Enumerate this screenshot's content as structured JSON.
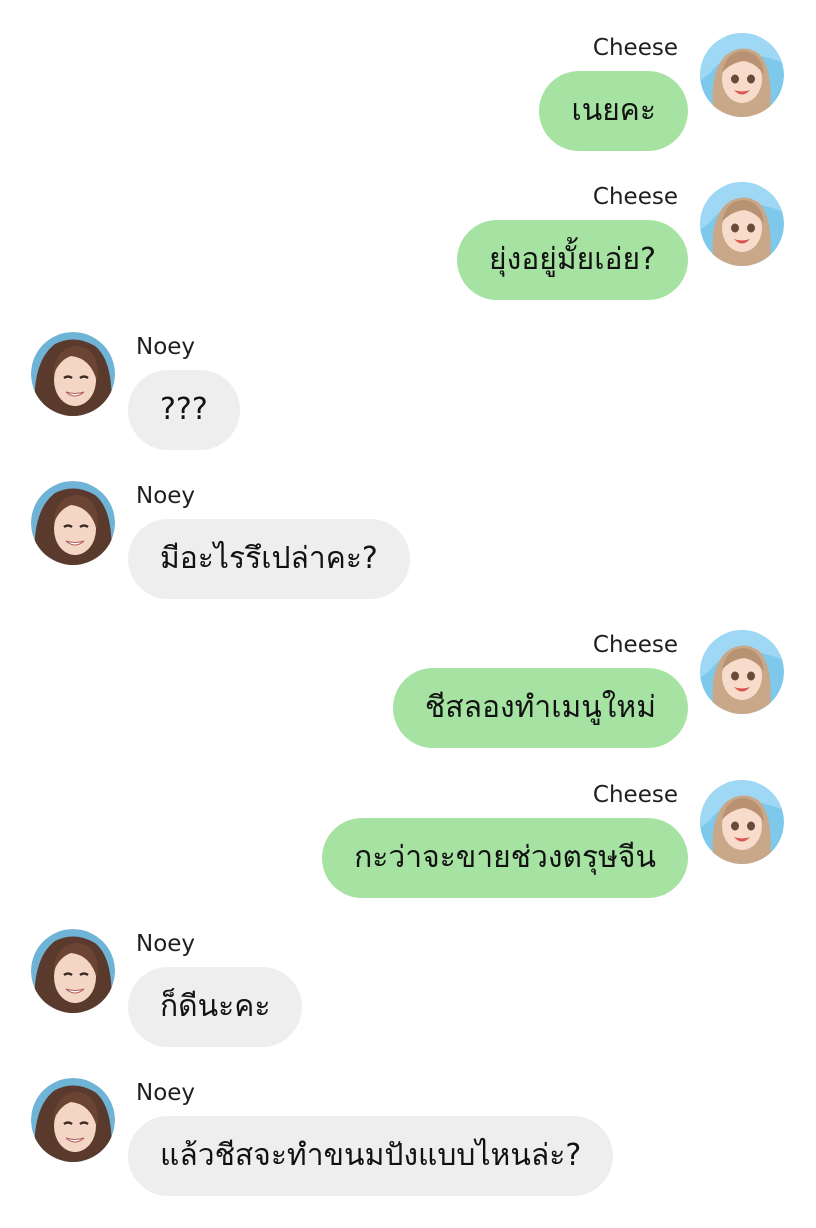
{
  "chat": {
    "messages": [
      {
        "sender": "Cheese",
        "side": "right",
        "text": "เนยคะ"
      },
      {
        "sender": "Cheese",
        "side": "right",
        "text": "ยุ่งอยู่มั้ยเอ่ย?"
      },
      {
        "sender": "Noey",
        "side": "left",
        "text": "???"
      },
      {
        "sender": "Noey",
        "side": "left",
        "text": "มีอะไรรึเปล่าคะ?"
      },
      {
        "sender": "Cheese",
        "side": "right",
        "text": "ชีสลองทำเมนูใหม่"
      },
      {
        "sender": "Cheese",
        "side": "right",
        "text": "กะว่าจะขายช่วงตรุษจีน"
      },
      {
        "sender": "Noey",
        "side": "left",
        "text": "ก็ดีนะคะ"
      },
      {
        "sender": "Noey",
        "side": "left",
        "text": "แล้วชีสจะทำขนมปังแบบไหนล่ะ?"
      }
    ]
  },
  "colors": {
    "outgoing_bubble": "#a6e3a3",
    "incoming_bubble": "#eeeeee",
    "background": "#ffffff"
  },
  "icons": {
    "cheese_avatar": "cheese-avatar-icon",
    "noey_avatar": "noey-avatar-icon"
  }
}
